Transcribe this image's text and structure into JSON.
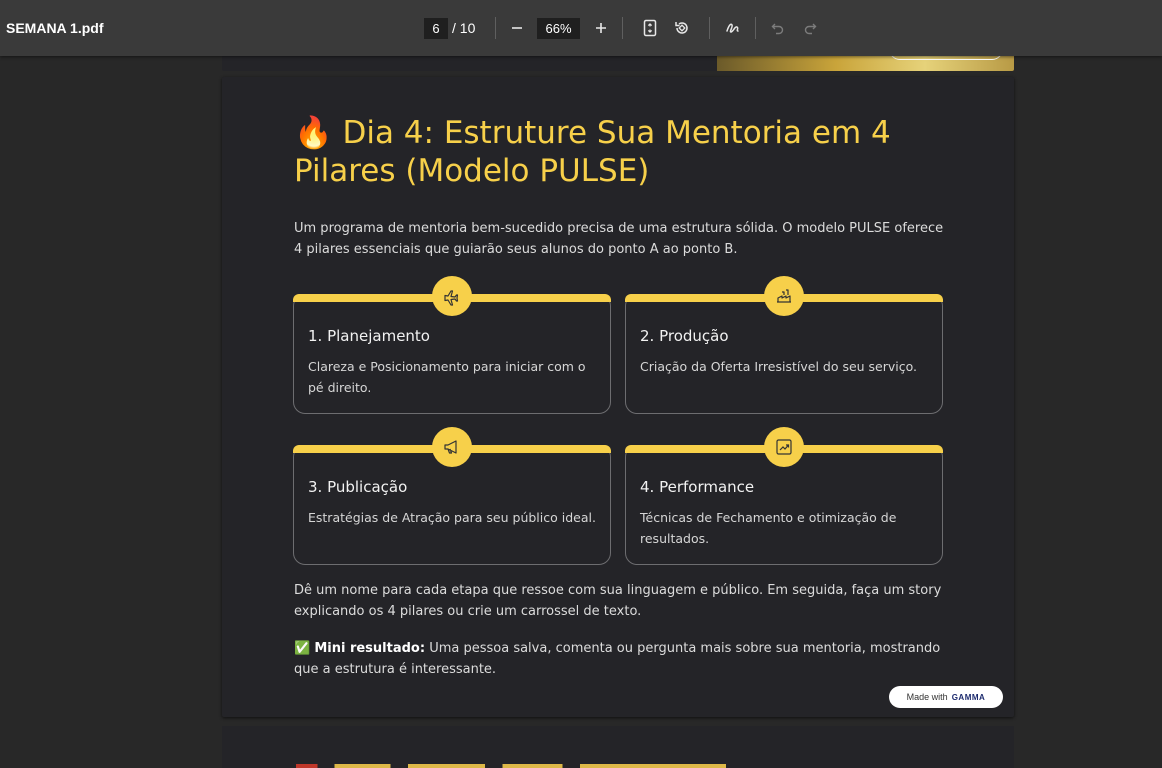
{
  "toolbar": {
    "doc_title": "SEMANA 1.pdf",
    "page_current": "6",
    "page_total": "/ 10",
    "zoom": "66%"
  },
  "page": {
    "heading_emoji": "🔥",
    "heading": "Dia 4: Estruture Sua Mentoria em 4 Pilares (Modelo PULSE)",
    "intro": "Um programa de mentoria bem-sucedido precisa de uma estrutura sólida. O modelo PULSE oferece 4 pilares essenciais que guiarão seus alunos do ponto A ao ponto B.",
    "cards": [
      {
        "title": "1. Planejamento",
        "text": "Clareza e Posicionamento para iniciar com o pé direito.",
        "icon": "airplane-icon"
      },
      {
        "title": "2. Produção",
        "text": "Criação da Oferta Irresistível do seu serviço.",
        "icon": "factory-icon"
      },
      {
        "title": "3. Publicação",
        "text": "Estratégias de Atração para seu público ideal.",
        "icon": "megaphone-icon"
      },
      {
        "title": "4. Performance",
        "text": "Técnicas de Fechamento e otimização de resultados.",
        "icon": "chart-up-icon"
      }
    ],
    "outro": "Dê um nome para cada etapa que ressoe com sua linguagem e público. Em seguida, faça um story explicando os 4 pilares ou crie um carrossel de texto.",
    "result_emoji": "✅",
    "result_label": "Mini resultado:",
    "result_text": " Uma pessoa salva, comenta ou pergunta mais sobre sua mentoria, mostrando que a estrutura é interessante.",
    "made_with": "Made with",
    "made_with_brand": "GAMMA"
  },
  "colors": {
    "accent": "#f7d04a",
    "page_bg": "#242428",
    "viewer_bg": "#282828",
    "toolbar_bg": "#3a3a3a"
  }
}
